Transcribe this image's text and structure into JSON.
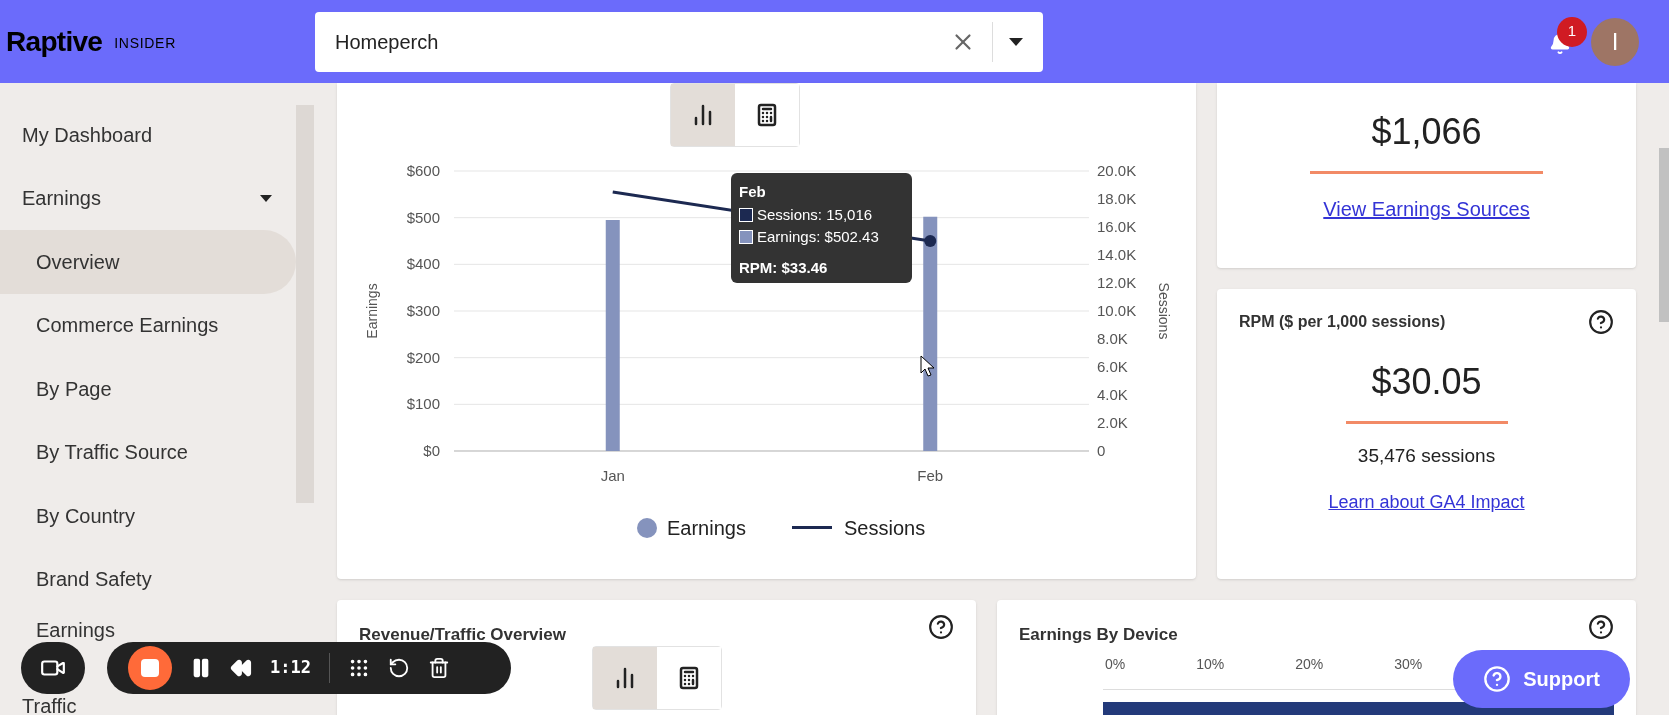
{
  "header": {
    "logo": "Raptive",
    "logo_sub": "INSIDER",
    "search": {
      "value": "Homeperch"
    },
    "notifications": "1",
    "avatar": "I"
  },
  "sidebar": {
    "items": [
      {
        "label": "My Dashboard",
        "selected": false,
        "kind": "top"
      },
      {
        "label": "Earnings",
        "selected": false,
        "kind": "group",
        "expanded": true
      },
      {
        "label": "Overview",
        "selected": true,
        "kind": "sub"
      },
      {
        "label": "Commerce Earnings",
        "selected": false,
        "kind": "sub"
      },
      {
        "label": "By Page",
        "selected": false,
        "kind": "sub"
      },
      {
        "label": "By Traffic Source",
        "selected": false,
        "kind": "sub"
      },
      {
        "label": "By Country",
        "selected": false,
        "kind": "sub"
      },
      {
        "label": "Brand Safety",
        "selected": false,
        "kind": "sub"
      },
      {
        "label": "Earnings",
        "selected": false,
        "kind": "sub"
      },
      {
        "label": "Traffic",
        "selected": false,
        "kind": "top"
      }
    ]
  },
  "earnings_chart": {
    "view_toggle": [
      {
        "kind": "chart",
        "selected": true
      },
      {
        "kind": "table",
        "selected": false
      }
    ],
    "earnings_axis": {
      "chart_data": {
        "type": "bar",
        "categories": [
          "Jan",
          "Feb"
        ],
        "ylabel": "Earnings",
        "grid": true,
        "series": [
          {
            "name": "Earnings",
            "color": "#8593bd",
            "values": [
              495,
              502
            ]
          }
        ],
        "ylim": [
          0,
          600
        ],
        "yticks": [
          {
            "value": 0,
            "label": "$0"
          },
          {
            "value": 100,
            "label": "$100"
          },
          {
            "value": 200,
            "label": "$200"
          },
          {
            "value": 300,
            "label": "$300"
          },
          {
            "value": 400,
            "label": "$400"
          },
          {
            "value": 500,
            "label": "$500"
          },
          {
            "value": 600,
            "label": "$600"
          }
        ]
      }
    },
    "sessions_axis": {
      "chart_data": {
        "type": "line",
        "ylabel": "Sessions",
        "series": [
          {
            "name": "Sessions",
            "color": "#1c2951",
            "values": [
              18500,
              15000
            ]
          }
        ],
        "ylim": [
          0,
          20000
        ],
        "yticks": [
          {
            "value": 0,
            "label": "0"
          },
          {
            "value": 2000,
            "label": "2.0K"
          },
          {
            "value": 4000,
            "label": "4.0K"
          },
          {
            "value": 6000,
            "label": "6.0K"
          },
          {
            "value": 8000,
            "label": "8.0K"
          },
          {
            "value": 10000,
            "label": "10.0K"
          },
          {
            "value": 12000,
            "label": "12.0K"
          },
          {
            "value": 14000,
            "label": "14.0K"
          },
          {
            "value": 16000,
            "label": "16.0K"
          },
          {
            "value": 18000,
            "label": "18.0K"
          },
          {
            "value": 20000,
            "label": "20.0K"
          }
        ]
      }
    },
    "tooltip": {
      "title": "Feb",
      "lines": [
        "Sessions: 15,016",
        "Earnings: $502.43"
      ],
      "footer": "RPM: $33.46"
    }
  },
  "total_card": {
    "value": "$1,066",
    "link": "View Earnings Sources"
  },
  "rpm_card": {
    "title": "RPM ($ per 1,000 sessions)",
    "value": "$30.05",
    "sessions": "35,476 sessions",
    "link": "Learn about GA4 Impact"
  },
  "revenue_card": {
    "title": "Revenue/Traffic Overview",
    "view_toggle": [
      {
        "kind": "chart",
        "selected": true
      },
      {
        "kind": "table",
        "selected": false
      }
    ]
  },
  "device_card": {
    "title": "Earnings By Device",
    "axis": [
      "0%",
      "10%",
      "20%",
      "30%"
    ]
  },
  "recorder": {
    "time": "1:12"
  },
  "support": {
    "label": "Support"
  }
}
